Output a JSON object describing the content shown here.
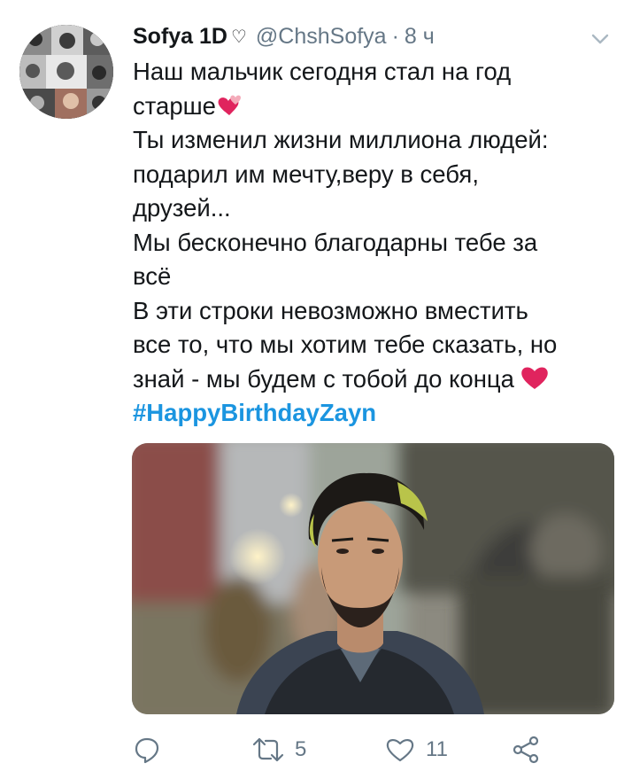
{
  "tweet": {
    "author_name": "Sofya 1D",
    "author_name_symbol": "♡",
    "handle": "@ChshSofya",
    "separator": "·",
    "time": "8 ч",
    "lines": [
      "Наш мальчик сегодня стал на год",
      "старше",
      "Ты изменил жизни миллиона людей:",
      "подарил им мечту,веру в себя,",
      "друзей...",
      "Мы бесконечно благодарны тебе за",
      "всё",
      "В эти строки невозможно вместить",
      "все то, что мы хотим тебе сказать, но",
      "знай - мы будем с тобой до конца"
    ],
    "hashtag": "#HappyBirthdayZayn"
  },
  "actions": {
    "reply_icon": "reply-icon",
    "retweet_icon": "retweet-icon",
    "retweet_count": "5",
    "like_icon": "like-icon",
    "like_count": "11",
    "share_icon": "share-icon"
  },
  "colors": {
    "text": "#14171a",
    "secondary": "#657786",
    "link": "#1b95e0",
    "emoji_red": "#e0245e"
  }
}
